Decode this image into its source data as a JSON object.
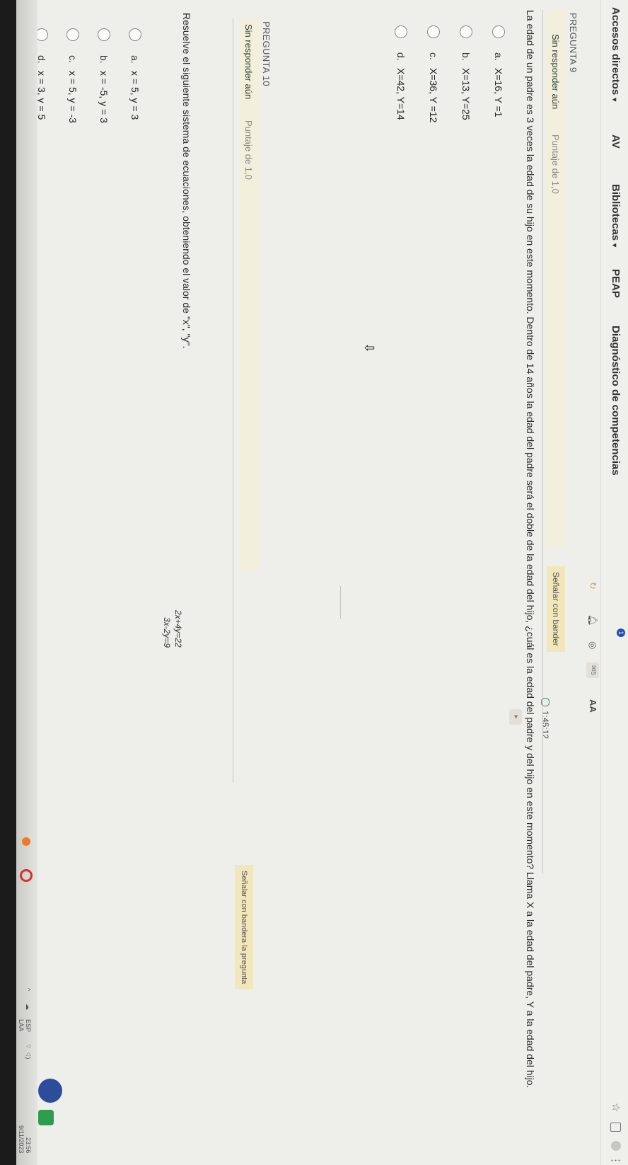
{
  "toolbar": {
    "bookmarks": [
      {
        "label": "Accesos directos",
        "caret": "▾"
      },
      {
        "label": "AV",
        "caret": ""
      },
      {
        "label": "Bibliotecas",
        "caret": "▾"
      },
      {
        "label": "PEAP",
        "caret": ""
      },
      {
        "label": "Diagnóstico de competencias",
        "caret": ""
      }
    ],
    "icons": [
      "star-icon",
      "square-icon",
      "profile-icon",
      "menu-dots-icon"
    ]
  },
  "top_icons": {
    "badge": "1",
    "text_size": "AA",
    "star": "☆",
    "more": "⋮"
  },
  "timer": {
    "value": "1:45:12"
  },
  "questions": [
    {
      "heading": "PREGUNTA 9",
      "status": "Sin responder aún",
      "points": "Puntaje de 1,0",
      "flag": "Señalar con bander",
      "text": "La edad de un padre es 3 veces la edad de su hijo en este momento. Dentro de 14 años la edad del padre será el doble de la edad del hijo, ¿cuál es la edad del padre y del hijo en este momento? Llama X a la edad del padre, Y a la edad del hijo.",
      "options": [
        {
          "letter": "a.",
          "text": "X=16, Y =1"
        },
        {
          "letter": "b.",
          "text": "X=13, Y=25"
        },
        {
          "letter": "c.",
          "text": "X=36, Y =12"
        },
        {
          "letter": "d.",
          "text": "X=42, Y=14"
        }
      ]
    },
    {
      "heading": "PREGUNTA 10",
      "status": "Sin responder aún",
      "points": "Puntaje de 1,0",
      "flag": "Señalar con bandera la pregunta",
      "text": "Resuelve el siguiente sistema de ecuaciones, obteniendo el valor de \"x\", \"y\".",
      "equations": [
        "2x+4y=22",
        "3x-2y=9"
      ],
      "options": [
        {
          "letter": "a.",
          "text": "x = 5, y = 3"
        },
        {
          "letter": "b.",
          "text": "x = -5, y = 3"
        },
        {
          "letter": "c.",
          "text": "x = 5, y = -3"
        },
        {
          "letter": "d.",
          "text": "x = 3, y = 5"
        }
      ]
    }
  ],
  "taskbar": {
    "lang": "ESP",
    "lang_sub": "LAA",
    "time": "23:56",
    "date": "9/11/2023"
  }
}
